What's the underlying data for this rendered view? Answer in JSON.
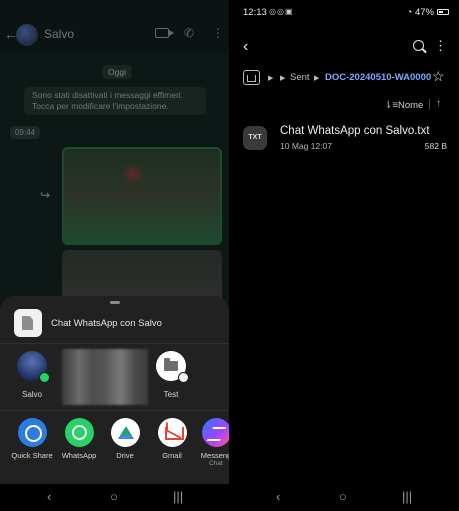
{
  "left": {
    "chat_header": {
      "contact_name": "Salvo"
    },
    "chat": {
      "day_chip": "Oggi",
      "system_note": "Sono stati disattivati i messaggi effimeri. Tocca per modificare l'impostazione.",
      "time_chip": "09:44"
    },
    "share_sheet": {
      "document_title": "Chat WhatsApp con Salvo",
      "contacts": [
        {
          "label": "Salvo",
          "icon": "avatar-icon"
        },
        {
          "label": "Test",
          "icon": "folder-icon"
        }
      ],
      "apps": [
        {
          "label": "Quick Share",
          "sub": "",
          "icon": "quick-share-icon",
          "color": "#2c7be0"
        },
        {
          "label": "WhatsApp",
          "sub": "",
          "icon": "whatsapp-icon",
          "color": "#25d366"
        },
        {
          "label": "Drive",
          "sub": "",
          "icon": "drive-icon",
          "color": "#1fa463"
        },
        {
          "label": "Gmail",
          "sub": "",
          "icon": "gmail-icon",
          "color": "#ea4335"
        },
        {
          "label": "Messeng",
          "sub": "Chat",
          "icon": "messenger-icon",
          "color": "#a044ff"
        }
      ]
    }
  },
  "right": {
    "status_bar": {
      "time": "12:13",
      "battery": "47%"
    },
    "breadcrumb": {
      "items": [
        "Sent",
        "DOC-20240510-WA0000"
      ]
    },
    "sort": {
      "label": "Nome"
    },
    "files": [
      {
        "type_badge": "TXT",
        "name": "Chat WhatsApp con Salvo.txt",
        "date": "10 Mag 12:07",
        "size": "582 B"
      }
    ]
  },
  "nav": {
    "recents": "|||",
    "home": "○",
    "back": "‹"
  }
}
